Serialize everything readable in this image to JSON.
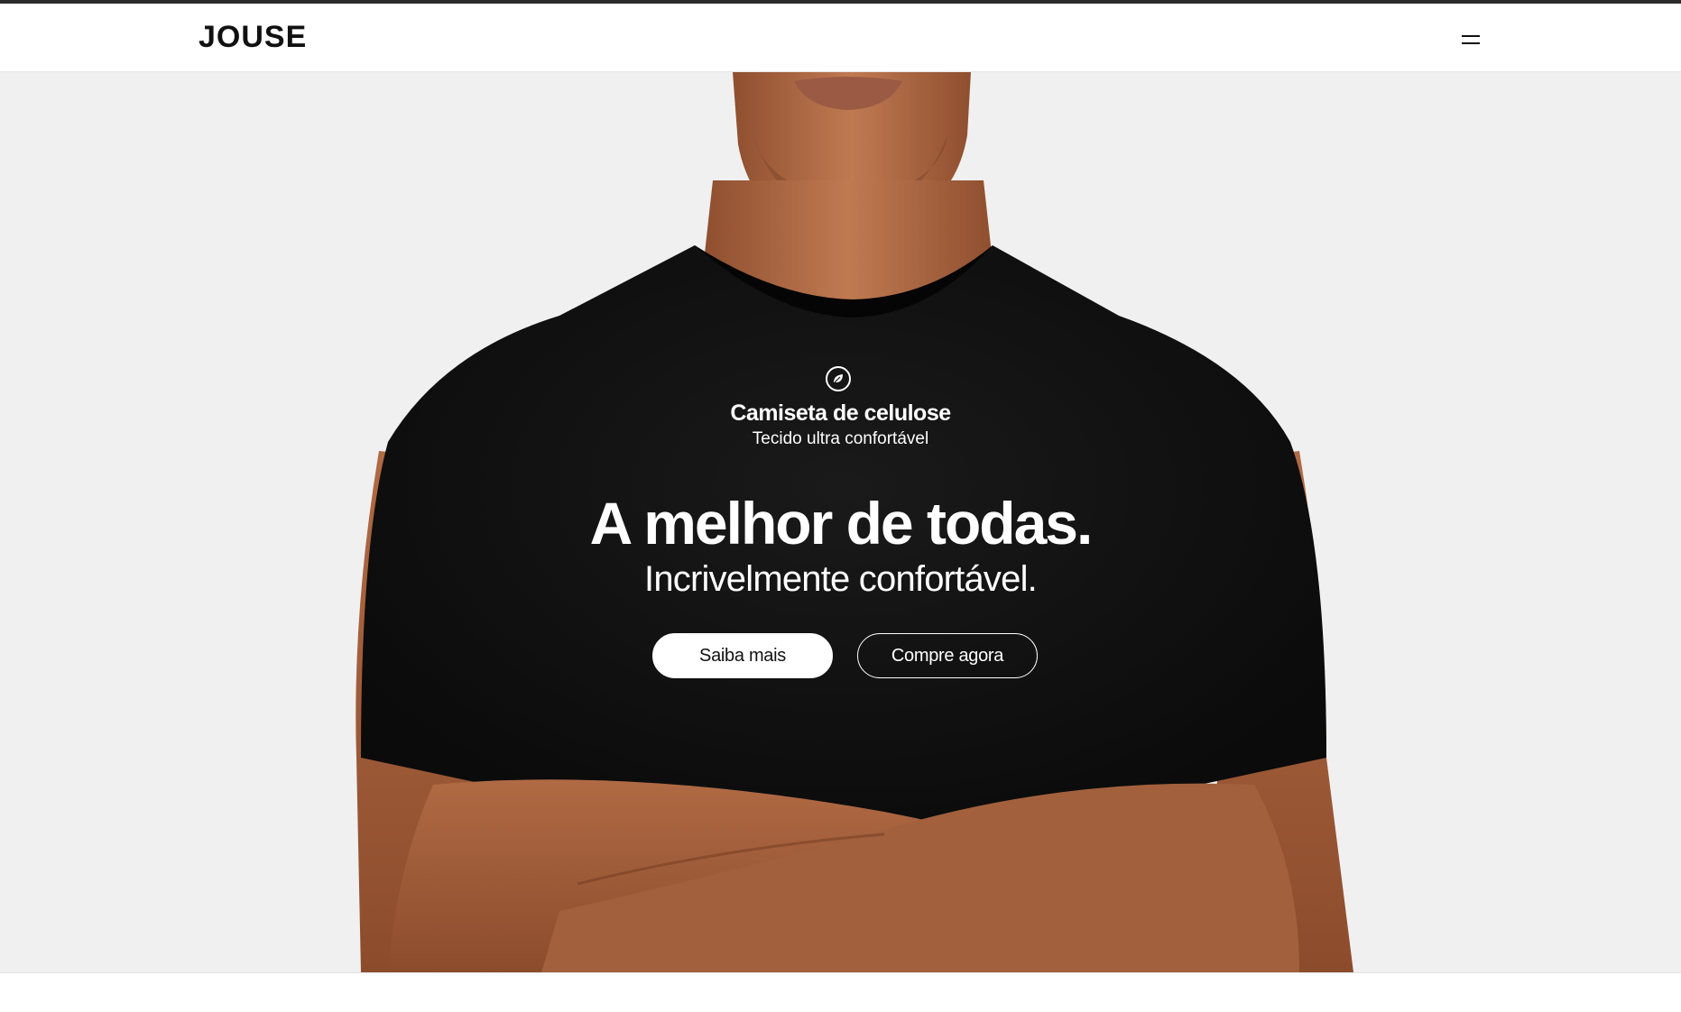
{
  "header": {
    "logo": "JOUSE",
    "menu_icon": "hamburger-menu-icon"
  },
  "hero": {
    "badge_icon": "leaf-icon",
    "product_name": "Camiseta de celulose",
    "product_subtitle": "Tecido ultra confortável",
    "headline": "A melhor de todas.",
    "subheadline": "Incrivelmente confortável.",
    "primary_button": "Saiba mais",
    "secondary_button": "Compre agora",
    "image": "model-black-tshirt-crossed-arms"
  },
  "colors": {
    "background": "#f0f0f0",
    "shirt": "#111111",
    "skin": "#b9714a",
    "text_on_dark": "#ffffff",
    "header_bg": "#ffffff"
  }
}
